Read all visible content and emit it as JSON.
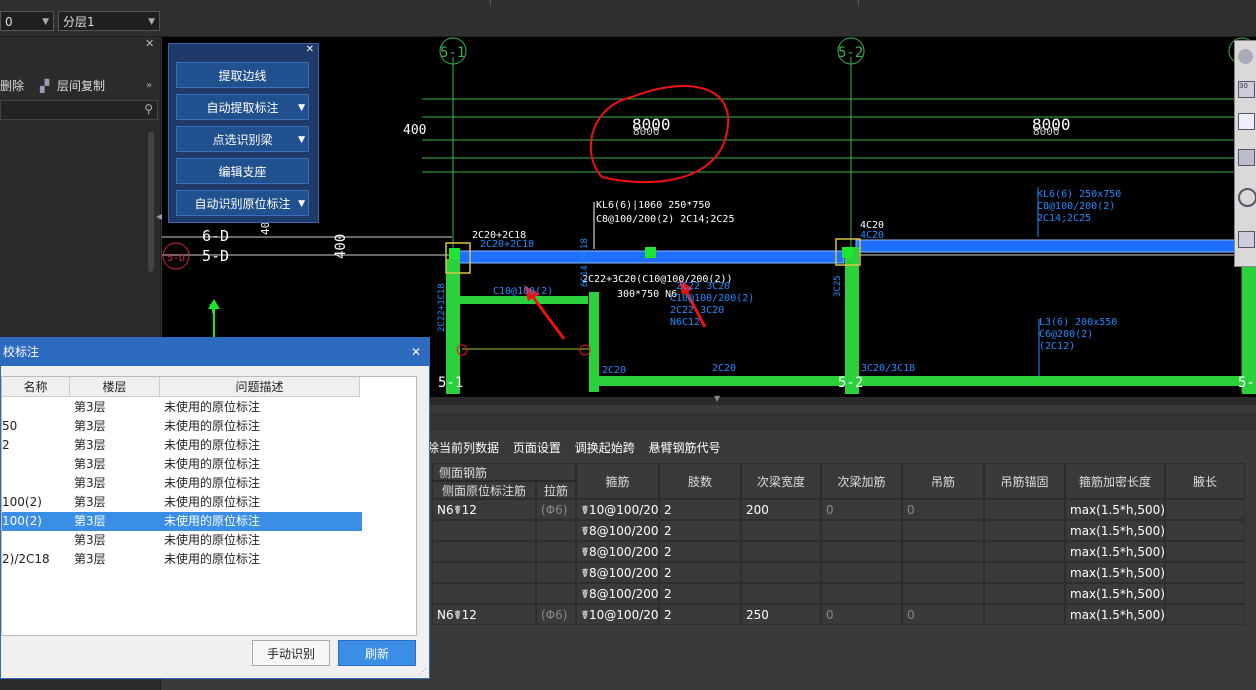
{
  "toolbar": {
    "combo1_value": "0",
    "combo2_value": "分层1"
  },
  "left_panel": {
    "delete_label": "删除",
    "copy_label": "层间复制"
  },
  "tool_panel": {
    "buttons": [
      "提取边线",
      "自动提取标注",
      "点选识别梁",
      "编辑支座",
      "自动识别原位标注"
    ]
  },
  "cad": {
    "axis_labels": [
      "5-1",
      "5-2",
      "5-1",
      "5-2",
      "5-",
      "6-D",
      "5-D",
      "5-D"
    ],
    "span1": "8000",
    "span1_shadow": "8000",
    "span2": "8000",
    "span2_shadow": "8000",
    "dim_400": "400",
    "dim_400_v": "400",
    "dim_40": "40",
    "beam_kl6_line1": "KL6(6)|1060 250*750",
    "beam_kl6_line2": "C8@100/200(2) 2C14;2C25",
    "beam_kl6_r1": "KL6(6) 250x750",
    "beam_kl6_r2": "C8@100/200(2)",
    "beam_kl6_r3": "2C14;2C25",
    "top_bar_left": "2C20+2C18",
    "top_bar_left2": "2C20+2C18",
    "top_bar_right": "4C20",
    "top_bar_right2": "4C20",
    "mid_note": "2C22+3C20(C10@100/200(2))",
    "mid_size": "300*750 N6",
    "c10": "C10@100(2)",
    "stir_block1": "C10@100/200(2)",
    "stir_block2": "2C22 3C20",
    "stir_block3": "N6C12",
    "stir_top": "2C22 3C20",
    "l3_1": "L3(6) 200x550",
    "l3_2": "C6@200(2)",
    "l3_3": "(2C12)",
    "bot_left": "2C20",
    "bot_mid": "2C20",
    "bot_right": "3C20/3C18",
    "col_left": "2C22+1C18",
    "col_mid": "6C14 5C18",
    "col_right": "3C25",
    "y_axis": "Y"
  },
  "table_toolbar": [
    "除当前列数据",
    "页面设置",
    "调换起始跨",
    "悬臂钢筋代号"
  ],
  "table": {
    "side_header": "侧面钢筋",
    "side_sub1": "侧面原位标注筋",
    "side_sub2": "拉筋",
    "headers": [
      "箍筋",
      "肢数",
      "次梁宽度",
      "次梁加筋",
      "吊筋",
      "吊筋锚固",
      "箍筋加密长度",
      "腋长"
    ],
    "rows": [
      {
        "side": "N6☤12",
        "tie": "(Φ6)",
        "stirrup": "☤10@100/200(2)",
        "legs": "2",
        "sec_w": "200",
        "sec_add": "0",
        "hang": "0",
        "anchor": "",
        "dense": "max(1.5*h,500)",
        "haunch": ""
      },
      {
        "side": "",
        "tie": "",
        "stirrup": "☤8@100/200(2)",
        "legs": "2",
        "sec_w": "",
        "sec_add": "",
        "hang": "",
        "anchor": "",
        "dense": "max(1.5*h,500)",
        "haunch": ""
      },
      {
        "side": "",
        "tie": "",
        "stirrup": "☤8@100/200(2)",
        "legs": "2",
        "sec_w": "",
        "sec_add": "",
        "hang": "",
        "anchor": "",
        "dense": "max(1.5*h,500)",
        "haunch": ""
      },
      {
        "side": "",
        "tie": "",
        "stirrup": "☤8@100/200(2)",
        "legs": "2",
        "sec_w": "",
        "sec_add": "",
        "hang": "",
        "anchor": "",
        "dense": "max(1.5*h,500)",
        "haunch": ""
      },
      {
        "side": "",
        "tie": "",
        "stirrup": "☤8@100/200(2)",
        "legs": "2",
        "sec_w": "",
        "sec_add": "",
        "hang": "",
        "anchor": "",
        "dense": "max(1.5*h,500)",
        "haunch": ""
      },
      {
        "side": "N6☤12",
        "tie": "(Φ6)",
        "stirrup": "☤10@100/200(2)",
        "legs": "2",
        "sec_w": "250",
        "sec_add": "0",
        "hang": "0",
        "anchor": "",
        "dense": "max(1.5*h,500)",
        "haunch": ""
      }
    ]
  },
  "dialog": {
    "title": "校标注",
    "headers": [
      "名称",
      "楼层",
      "问题描述"
    ],
    "rows": [
      {
        "name": "",
        "floor": "第3层",
        "desc": "未使用的原位标注"
      },
      {
        "name": "50",
        "floor": "第3层",
        "desc": "未使用的原位标注"
      },
      {
        "name": "2",
        "floor": "第3层",
        "desc": "未使用的原位标注"
      },
      {
        "name": "",
        "floor": "第3层",
        "desc": "未使用的原位标注"
      },
      {
        "name": "",
        "floor": "第3层",
        "desc": "未使用的原位标注"
      },
      {
        "name": "100(2)",
        "floor": "第3层",
        "desc": "未使用的原位标注"
      },
      {
        "name": "100(2)",
        "floor": "第3层",
        "desc": "未使用的原位标注"
      },
      {
        "name": "",
        "floor": "第3层",
        "desc": "未使用的原位标注"
      },
      {
        "name": "2)/2C18",
        "floor": "第3层",
        "desc": "未使用的原位标注"
      }
    ],
    "selected_index": 6,
    "manual_label": "手动识别",
    "refresh_label": "刷新"
  }
}
